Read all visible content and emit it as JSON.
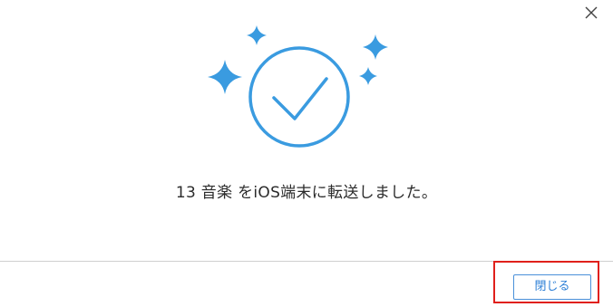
{
  "dialog": {
    "message": "13 音楽 をiOS端末に転送しました。",
    "close_button_label": "閉じる",
    "icons": {
      "close": "close-icon",
      "checkmark": "check-circle-icon",
      "sparkles": "sparkle-icon"
    }
  },
  "colors": {
    "accent": "#3a9be0",
    "highlight": "#e0201b",
    "button_text": "#2d7fd6"
  }
}
